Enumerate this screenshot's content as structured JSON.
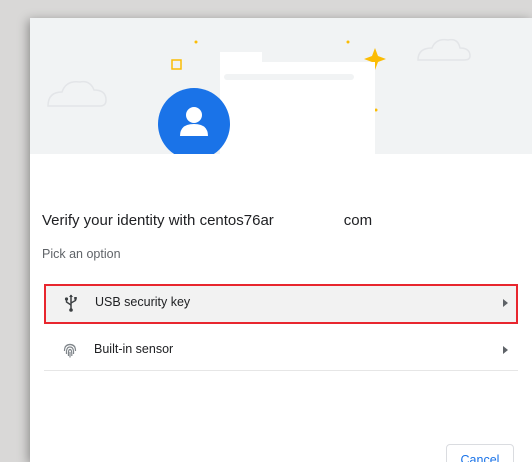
{
  "dialog": {
    "title_prefix": "Verify your identity with centos76ar",
    "title_suffix": "com",
    "subtitle": "Pick an option",
    "options": [
      {
        "label": "USB security key",
        "icon": "usb-icon"
      },
      {
        "label": "Built-in sensor",
        "icon": "fingerprint-icon"
      }
    ],
    "cancel_label": "Cancel"
  },
  "colors": {
    "accent": "#1a73e8",
    "avatar": "#1a73e8",
    "highlight_border": "#e8262e",
    "sparkle": "#fbbc04"
  }
}
